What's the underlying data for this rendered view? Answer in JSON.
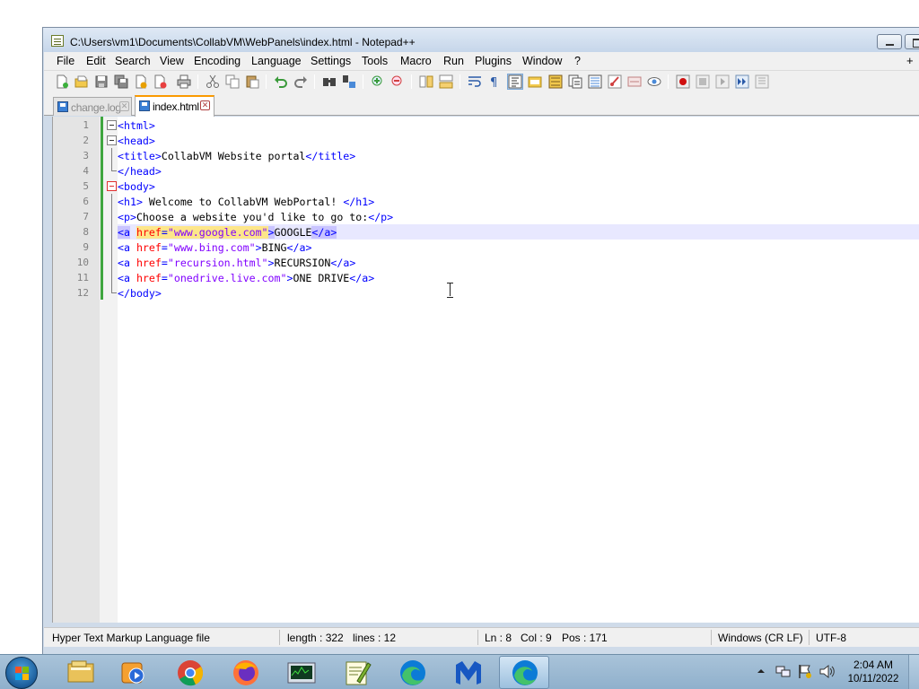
{
  "window": {
    "title": "C:\\Users\\vm1\\Documents\\CollabVM\\WebPanels\\index.html - Notepad++"
  },
  "menu": {
    "items": [
      "File",
      "Edit",
      "Search",
      "View",
      "Encoding",
      "Language",
      "Settings",
      "Tools",
      "Macro",
      "Run",
      "Plugins",
      "Window",
      "?"
    ],
    "plus": "+"
  },
  "toolbar": {
    "icons": [
      "new-file-icon",
      "open-file-icon",
      "save-icon",
      "save-all-icon",
      "close-icon",
      "close-all-icon",
      "print-icon",
      "cut-icon",
      "copy-icon",
      "paste-icon",
      "undo-icon",
      "redo-icon",
      "find-icon",
      "replace-icon",
      "zoom-in-icon",
      "zoom-out-icon",
      "sync-vertical-icon",
      "sync-horizontal-icon",
      "word-wrap-icon",
      "show-all-chars-icon",
      "indent-guide-icon",
      "folder-workspace-icon",
      "document-map-icon",
      "function-list-icon",
      "doc-list-icon",
      "launch-browser-icon",
      "eye-monitor-icon",
      "record-macro-icon",
      "stop-macro-icon",
      "play-macro-icon",
      "run-macro-multiple-icon",
      "save-macro-icon"
    ]
  },
  "tabs": [
    {
      "label": "change.log",
      "active": false
    },
    {
      "label": "index.html",
      "active": true
    }
  ],
  "editor": {
    "lines": [
      {
        "n": "1",
        "text": "<html>"
      },
      {
        "n": "2",
        "text": "<head>"
      },
      {
        "n": "3",
        "text": "<title>CollabVM Website portal</title>"
      },
      {
        "n": "4",
        "text": "</head>"
      },
      {
        "n": "5",
        "text": "<body>"
      },
      {
        "n": "6",
        "text": "<h1> Welcome to CollabVM WebPortal! </h1>"
      },
      {
        "n": "7",
        "text": "<p>Choose a website you'd like to go to:</p>"
      },
      {
        "n": "8",
        "text": "<a href=\"www.google.com\">GOOGLE</a>"
      },
      {
        "n": "9",
        "text": "<a href=\"www.bing.com\">BING</a>"
      },
      {
        "n": "10",
        "text": "<a href=\"recursion.html\">RECURSION</a>"
      },
      {
        "n": "11",
        "text": "<a href=\"onedrive.live.com\">ONE DRIVE</a>"
      },
      {
        "n": "12",
        "text": "</body>"
      }
    ],
    "current_line": 8
  },
  "status": {
    "file_type": "Hyper Text Markup Language file",
    "length": "length : 322",
    "lines": "lines : 12",
    "ln": "Ln : 8",
    "col": "Col : 9",
    "pos": "Pos : 171",
    "eol": "Windows (CR LF)",
    "encoding": "UTF-8"
  },
  "taskbar": {
    "apps": [
      "file-explorer-icon",
      "media-player-icon",
      "chrome-icon",
      "firefox-icon",
      "task-manager-icon",
      "notepadpp-icon",
      "edge-icon",
      "malwarebytes-icon",
      "edge-active-icon"
    ],
    "time": "2:04 AM",
    "date": "10/11/2022"
  },
  "colors": {
    "tag": "#0000ff",
    "attribute": "#ff0000",
    "string": "#8000ff",
    "tab_active_accent": "#fa9a00",
    "change_bar": "#3fa63f"
  }
}
